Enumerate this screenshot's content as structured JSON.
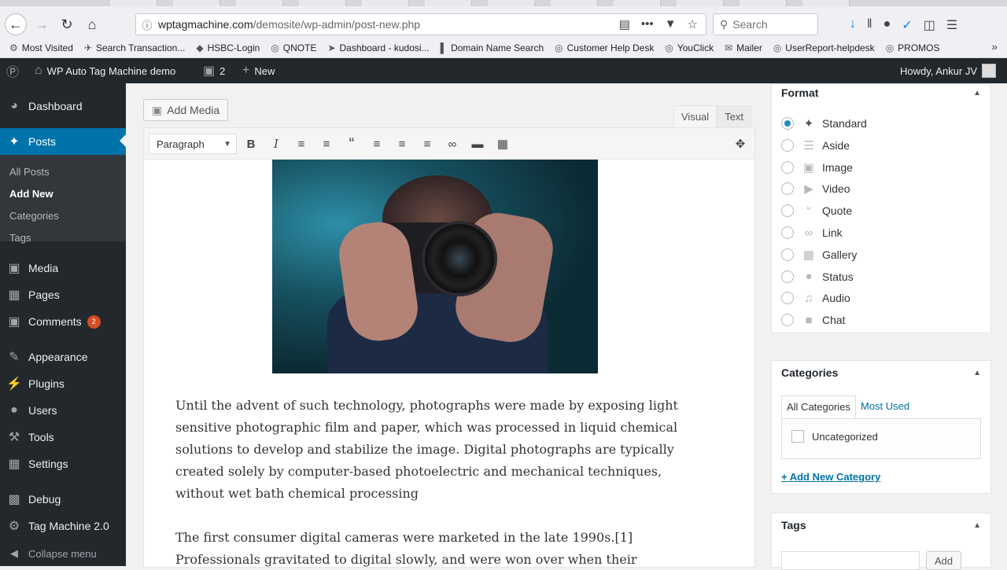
{
  "browser": {
    "url_host": "wptagmachine.com",
    "url_path": "/demosite/wp-admin/post-new.php",
    "search_placeholder": "Search",
    "bookmarks": [
      {
        "label": "Most Visited",
        "icon": "gear-icon"
      },
      {
        "label": "Search Transaction...",
        "icon": "airline-icon"
      },
      {
        "label": "HSBC-Login",
        "icon": "hsbc-icon"
      },
      {
        "label": "QNOTE",
        "icon": "globe-icon"
      },
      {
        "label": "Dashboard - kudosi...",
        "icon": "plane-icon"
      },
      {
        "label": "Domain Name Search",
        "icon": "bar-icon"
      },
      {
        "label": "Customer Help Desk",
        "icon": "globe-icon"
      },
      {
        "label": "YouClick",
        "icon": "globe-icon"
      },
      {
        "label": "Mailer",
        "icon": "mail-icon"
      },
      {
        "label": "UserReport-helpdesk",
        "icon": "globe-icon"
      },
      {
        "label": "PROMOS",
        "icon": "globe-icon"
      }
    ]
  },
  "adminbar": {
    "site_name": "WP Auto Tag Machine demo",
    "comments_count": "2",
    "new_label": "New",
    "howdy": "Howdy, Ankur JV"
  },
  "sidebar": {
    "dashboard": "Dashboard",
    "posts": "Posts",
    "sub": [
      "All Posts",
      "Add New",
      "Categories",
      "Tags"
    ],
    "media": "Media",
    "pages": "Pages",
    "comments": "Comments",
    "comments_badge": "2",
    "appearance": "Appearance",
    "plugins": "Plugins",
    "users": "Users",
    "tools": "Tools",
    "settings": "Settings",
    "debug": "Debug",
    "tag_machine": "Tag Machine 2.0",
    "collapse": "Collapse menu"
  },
  "editor": {
    "add_media": "Add Media",
    "tab_visual": "Visual",
    "tab_text": "Text",
    "format_select": "Paragraph",
    "paragraph1": "Until the advent of such technology, photographs were made by exposing light sensitive photographic film and paper, which was processed in liquid chemical solutions to develop and stabilize the image. Digital photographs are typically created solely by computer-based photoelectric and mechanical techniques, without wet bath chemical processing",
    "paragraph2_line1": "The first consumer digital cameras were marketed in the late 1990s.[1]",
    "paragraph2_line2": "Professionals gravitated to digital slowly, and were won over when their"
  },
  "format_box": {
    "title": "Format",
    "options": [
      "Standard",
      "Aside",
      "Image",
      "Video",
      "Quote",
      "Link",
      "Gallery",
      "Status",
      "Audio",
      "Chat"
    ],
    "selected": "Standard"
  },
  "categories_box": {
    "title": "Categories",
    "tab_all": "All Categories",
    "tab_most_used": "Most Used",
    "items": [
      "Uncategorized"
    ],
    "add_new": "+ Add New Category"
  },
  "tags_box": {
    "title": "Tags",
    "add_button": "Add"
  },
  "colors": {
    "wp_dark": "#23282d",
    "wp_blue": "#0073aa",
    "badge": "#d54e21"
  }
}
